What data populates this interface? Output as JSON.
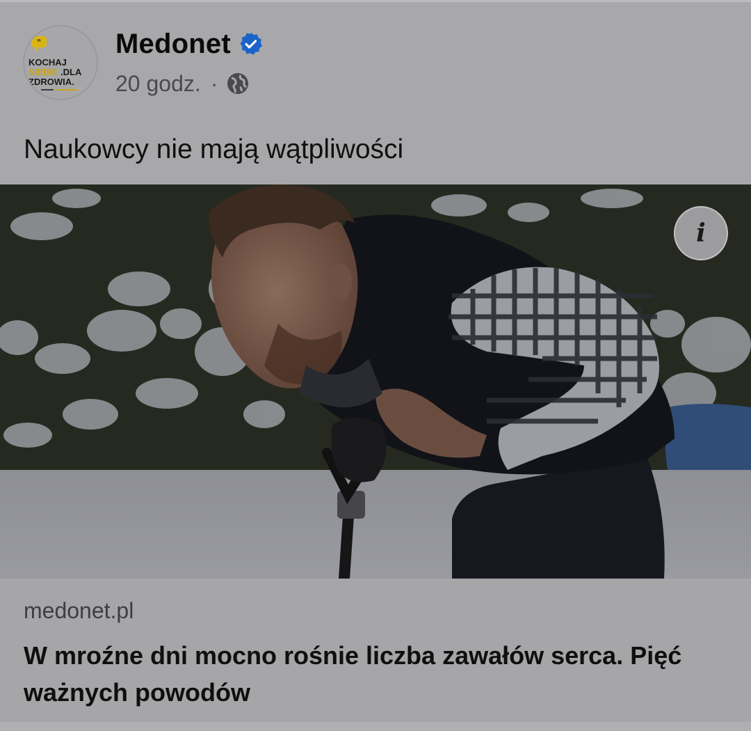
{
  "post": {
    "page_name": "Medonet",
    "time": "20 godz.",
    "separator": "·",
    "caption": "Naukowcy nie mają wątpliwości",
    "avatar_text": {
      "line1": "KOCHAJ",
      "line2a": "SIEBIE",
      "line2b": ".DLA",
      "line3": "ZDROWIA.",
      "quote": "”"
    },
    "icons": {
      "verified": "verified-badge-icon",
      "privacy": "globe-icon",
      "info": "info-icon"
    },
    "info_label": "i"
  },
  "link": {
    "domain": "medonet.pl",
    "title": "W mroźne dni mocno rośnie liczba zawałów serca. Pięć ważnych powodów"
  },
  "colors": {
    "accent_yellow": "#e6c21a",
    "verified_blue": "#1877f2",
    "background": "#a8a8aa"
  }
}
